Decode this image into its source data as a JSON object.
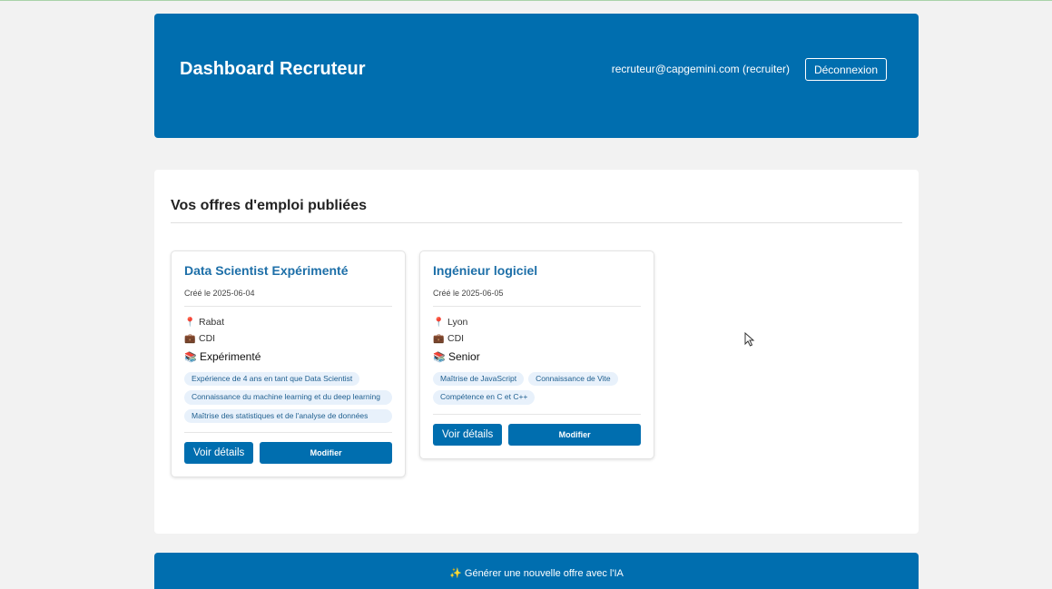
{
  "header": {
    "title": "Dashboard Recruteur",
    "user": "recruteur@capgemini.com (recruiter)",
    "logout_label": "Déconnexion"
  },
  "offers_section": {
    "title": "Vos offres d'emploi publiées"
  },
  "offers": [
    {
      "title": "Data Scientist Expérimenté",
      "created": "Créé le 2025-06-04",
      "location": "Rabat",
      "contract": "CDI",
      "level": "Expérimenté",
      "skills": [
        "Expérience de 4 ans en tant que Data Scientist",
        "Connaissance du machine learning et du deep learning",
        "Maîtrise des statistiques et de l'analyse de données"
      ],
      "details_label": "Voir détails",
      "edit_label": "Modifier"
    },
    {
      "title": "Ingénieur logiciel",
      "created": "Créé le 2025-06-05",
      "location": "Lyon",
      "contract": "CDI",
      "level": "Senior",
      "skills": [
        "Maîtrise de JavaScript",
        "Connaissance de Vite",
        "Compétence en C et C++"
      ],
      "details_label": "Voir détails",
      "edit_label": "Modifier"
    }
  ],
  "generate": {
    "icon": "sparkles-icon",
    "label": "✨ Générer une nouvelle offre avec l'IA"
  },
  "icons": {
    "location": "pin-icon",
    "contract": "briefcase-icon",
    "level": "books-icon"
  },
  "colors": {
    "primary": "#006eaf",
    "title_link": "#1d6fa8",
    "tag_bg": "#e8f1fb"
  }
}
